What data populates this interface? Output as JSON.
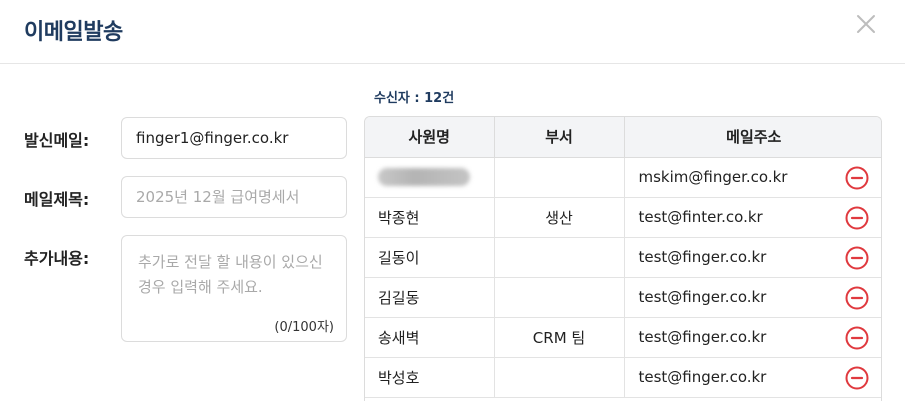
{
  "dialog": {
    "title": "이메일발송"
  },
  "form": {
    "sender_label": "발신메일:",
    "sender_value": "finger1@finger.co.kr",
    "subject_label": "메일제목:",
    "subject_placeholder": "2025년 12월 급여명세서",
    "content_label": "추가내용:",
    "content_placeholder": "추가로 전달 할 내용이 있으신 경우 입력해 주세요.",
    "content_counter": "(0/100자)"
  },
  "recipients": {
    "count_label": "수신자 : 12건",
    "headers": [
      "사원명",
      "부서",
      "메일주소"
    ],
    "rows": [
      {
        "name": "",
        "dept": "",
        "email": "mskim@finger.co.kr",
        "name_redacted": true
      },
      {
        "name": "박종현",
        "dept": "생산",
        "email": "test@finter.co.kr"
      },
      {
        "name": "길동이",
        "dept": "",
        "email": "test@finger.co.kr"
      },
      {
        "name": "김길동",
        "dept": "",
        "email": "test@finger.co.kr"
      },
      {
        "name": "송새벽",
        "dept": "CRM 팀",
        "email": "test@finger.co.kr"
      },
      {
        "name": "박성호",
        "dept": "",
        "email": "test@finger.co.kr"
      }
    ]
  },
  "icons": {
    "close": "close-icon",
    "remove": "minus-circle-icon"
  },
  "colors": {
    "title": "#1f3b5f",
    "remove": "#e0393e",
    "header_bg": "#f3f4f6"
  }
}
